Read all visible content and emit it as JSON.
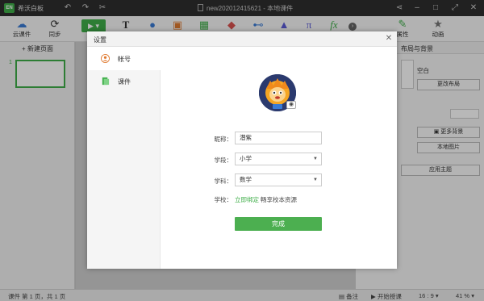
{
  "titlebar": {
    "logo_text": "EN",
    "app_name": "希沃白板",
    "doc_title": "new202012415621 - 本地课件"
  },
  "toolbar": {
    "cloud_label": "云课件",
    "sync_label": "同步",
    "insert_tools": [
      "T",
      "●",
      "▣",
      "▦",
      "◆",
      "⊷",
      "▲",
      "π",
      "fx"
    ],
    "attr_label": "属性",
    "anim_label": "动画"
  },
  "slides": {
    "new_page_label": "+ 新建页面",
    "items": [
      {
        "num": "1"
      }
    ]
  },
  "right_panel": {
    "title": "布局与背景",
    "blank_label": "空白",
    "change_layout": "更改布局",
    "more_bg": "更多背景",
    "local_image": "本地图片",
    "apply_theme": "应用主题"
  },
  "statusbar": {
    "page_info": "课件 第 1 页，共 1 页",
    "notes": "备注",
    "start_teach": "开始授课",
    "ratio": "16 : 9",
    "zoom": "41 %"
  },
  "dialog": {
    "title": "设置",
    "nav": [
      {
        "label": "帐号",
        "icon": "user-icon"
      },
      {
        "label": "课件",
        "icon": "document-icon"
      }
    ],
    "nickname_label": "昵称：",
    "nickname_value": "潜紫",
    "stage_label": "学段：",
    "stage_value": "小学",
    "subject_label": "学科：",
    "subject_value": "数学",
    "school_label": "学校：",
    "school_link": "立即绑定",
    "school_note": "畅享校本资源",
    "done_label": "完成"
  },
  "colors": {
    "accent": "#3fae49",
    "titlebar_bg": "#2f2f2f"
  }
}
